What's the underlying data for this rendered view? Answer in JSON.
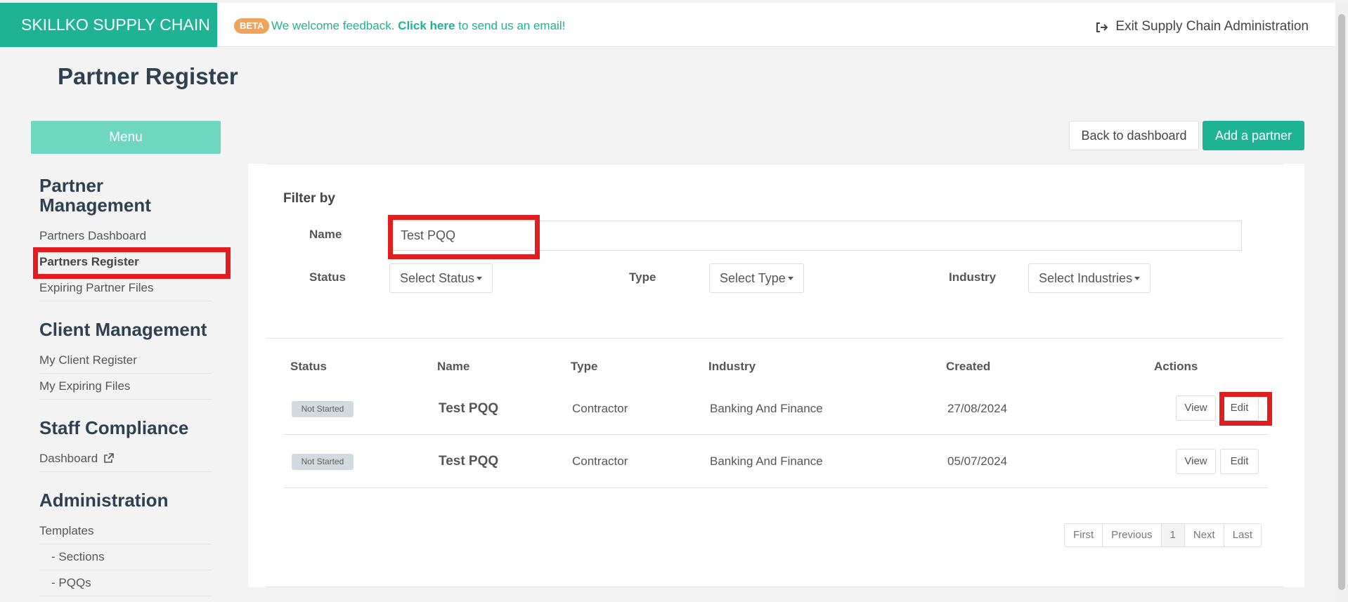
{
  "brand": "SKILLKO SUPPLY CHAIN",
  "topbar": {
    "beta": "BETA",
    "feedback_prefix": "We welcome feedback.",
    "feedback_link": "Click here",
    "feedback_suffix": "to send us an email!",
    "exit_label": "Exit Supply Chain Administration",
    "exit_icon": "sign-out-icon"
  },
  "page_title": "Partner Register",
  "menu_label": "Menu",
  "sidebar": {
    "sections": [
      {
        "title": "Partner Management",
        "items": [
          "Partners Dashboard",
          "Partners Register",
          "Expiring Partner Files"
        ]
      },
      {
        "title": "Client Management",
        "items": [
          "My Client Register",
          "My Expiring Files"
        ]
      },
      {
        "title": "Staff Compliance",
        "items": [
          "Dashboard"
        ]
      },
      {
        "title": "Administration",
        "items": [
          "Templates",
          "- Sections",
          "- PQQs"
        ]
      }
    ],
    "active_item": "Partners Register"
  },
  "buttons": {
    "back": "Back to dashboard",
    "add": "Add a partner"
  },
  "filter": {
    "title": "Filter by",
    "name_label": "Name",
    "name_value": "Test PQQ",
    "status_label": "Status",
    "status_select": "Select Status",
    "type_label": "Type",
    "type_select": "Select Type",
    "industry_label": "Industry",
    "industry_select": "Select Industries"
  },
  "table": {
    "headers": [
      "Status",
      "Name",
      "Type",
      "Industry",
      "Created",
      "Actions"
    ],
    "rows": [
      {
        "status": "Not Started",
        "name": "Test PQQ",
        "type": "Contractor",
        "industry": "Banking And Finance",
        "created": "27/08/2024",
        "view": "View",
        "edit": "Edit"
      },
      {
        "status": "Not Started",
        "name": "Test PQQ",
        "type": "Contractor",
        "industry": "Banking And Finance",
        "created": "05/07/2024",
        "view": "View",
        "edit": "Edit"
      }
    ]
  },
  "pagination": [
    "First",
    "Previous",
    "1",
    "Next",
    "Last"
  ],
  "colors": {
    "brand": "#1db394",
    "menu": "#6fd6bf",
    "highlight": "#e11d1d",
    "beta": "#f0a45a"
  }
}
